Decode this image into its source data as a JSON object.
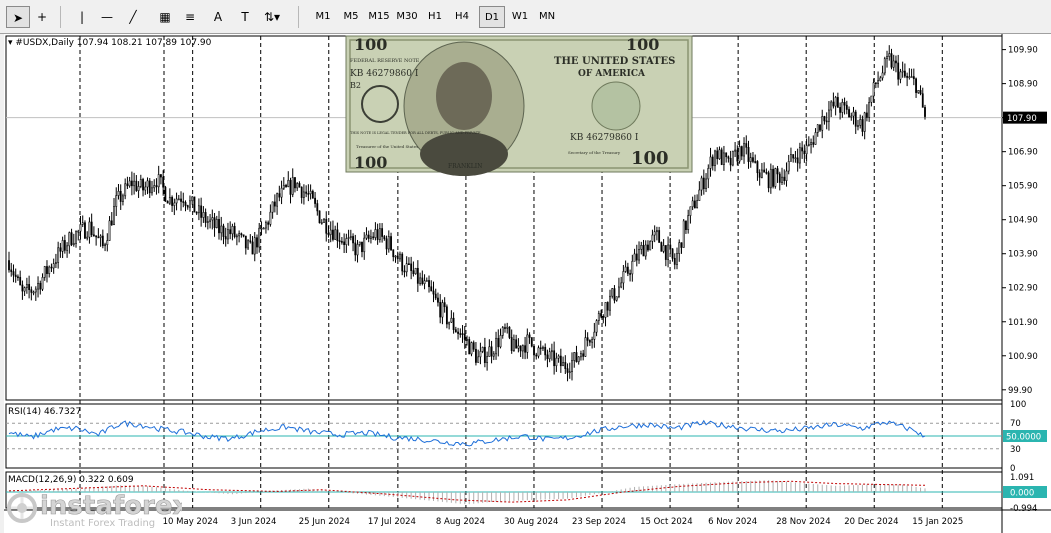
{
  "toolbar": {
    "tools": [
      {
        "name": "cursor-tool",
        "icon": "cursor-icon",
        "glyph": "➤"
      },
      {
        "name": "crosshair-tool",
        "icon": "crosshair-icon",
        "glyph": "+"
      },
      {
        "name": "vertical-line-tool",
        "icon": "vertical-line-icon",
        "glyph": "|"
      },
      {
        "name": "horizontal-line-tool",
        "icon": "horizontal-line-icon",
        "glyph": "—"
      },
      {
        "name": "trendline-tool",
        "icon": "trendline-icon",
        "glyph": "╱"
      },
      {
        "name": "channel-tool",
        "icon": "channel-icon",
        "glyph": "▦"
      },
      {
        "name": "fibonacci-tool",
        "icon": "fibonacci-icon",
        "glyph": "≡"
      },
      {
        "name": "text-tool",
        "icon": "text-icon",
        "glyph": "A"
      },
      {
        "name": "text-label-tool",
        "icon": "text-label-icon",
        "glyph": "T"
      },
      {
        "name": "arrows-tool",
        "icon": "arrows-icon",
        "glyph": "⇅▾"
      }
    ],
    "timeframes": [
      "M1",
      "M5",
      "M15",
      "M30",
      "H1",
      "H4",
      "D1",
      "W1",
      "MN"
    ],
    "active_timeframe": "D1"
  },
  "chart_data": [
    {
      "type": "candlestick",
      "symbol_info": "#USDX,Daily  107.94 108.21 107.89 107.90",
      "current_price_label": "107.90",
      "current_price": 107.9,
      "ylim": [
        99.6,
        110.3
      ],
      "y_ticks": [
        "109.90",
        "108.90",
        "107.90",
        "106.90",
        "105.90",
        "104.90",
        "103.90",
        "102.90",
        "101.90",
        "100.90",
        "99.90"
      ],
      "x_ticks": [
        "10 May 2024",
        "3 Jun 2024",
        "25 Jun 2024",
        "17 Jul 2024",
        "8 Aug 2024",
        "30 Aug 2024",
        "23 Sep 2024",
        "15 Oct 2024",
        "6 Nov 2024",
        "28 Nov 2024",
        "20 Dec 2024",
        "15 Jan 2025"
      ],
      "x_tick_positions": [
        0.184,
        0.249,
        0.314,
        0.38,
        0.445,
        0.51,
        0.575,
        0.64,
        0.705,
        0.77,
        0.835,
        0.9
      ],
      "grid": "vertical-dashed",
      "anchors": [
        [
          0,
          103.7
        ],
        [
          6,
          102.7
        ],
        [
          12,
          102.9
        ],
        [
          20,
          103.7
        ],
        [
          28,
          104.4
        ],
        [
          36,
          104.7
        ],
        [
          42,
          104.1
        ],
        [
          48,
          105.4
        ],
        [
          55,
          106.0
        ],
        [
          60,
          105.8
        ],
        [
          66,
          106.1
        ],
        [
          72,
          105.5
        ],
        [
          78,
          105.6
        ],
        [
          86,
          105.0
        ],
        [
          94,
          104.6
        ],
        [
          100,
          104.5
        ],
        [
          108,
          104.0
        ],
        [
          114,
          104.6
        ],
        [
          120,
          105.5
        ],
        [
          128,
          106.0
        ],
        [
          134,
          105.6
        ],
        [
          140,
          104.9
        ],
        [
          148,
          104.4
        ],
        [
          156,
          104.0
        ],
        [
          164,
          104.5
        ],
        [
          170,
          104.2
        ],
        [
          176,
          103.6
        ],
        [
          182,
          103.2
        ],
        [
          188,
          102.8
        ],
        [
          196,
          102.0
        ],
        [
          204,
          101.4
        ],
        [
          210,
          100.8
        ],
        [
          216,
          101.1
        ],
        [
          222,
          101.6
        ],
        [
          226,
          101.1
        ],
        [
          232,
          101.3
        ],
        [
          240,
          100.9
        ],
        [
          248,
          100.6
        ],
        [
          254,
          100.8
        ],
        [
          260,
          101.5
        ],
        [
          266,
          102.3
        ],
        [
          272,
          102.8
        ],
        [
          278,
          103.5
        ],
        [
          284,
          104.1
        ],
        [
          290,
          104.4
        ],
        [
          294,
          104.0
        ],
        [
          298,
          103.6
        ],
        [
          302,
          104.6
        ],
        [
          310,
          105.9
        ],
        [
          316,
          106.9
        ],
        [
          322,
          106.5
        ],
        [
          328,
          107.0
        ],
        [
          334,
          106.4
        ],
        [
          340,
          106.1
        ],
        [
          346,
          106.2
        ],
        [
          352,
          106.8
        ],
        [
          358,
          107.0
        ],
        [
          364,
          107.9
        ],
        [
          370,
          108.3
        ],
        [
          376,
          108.0
        ],
        [
          382,
          107.7
        ],
        [
          388,
          108.9
        ],
        [
          394,
          109.6
        ],
        [
          400,
          109.1
        ],
        [
          406,
          108.9
        ],
        [
          410,
          107.9
        ]
      ],
      "n_bars": 411
    },
    {
      "type": "line",
      "label": "RSI(14) 46.7327",
      "level_label": "50.0000",
      "ylim": [
        0,
        100
      ],
      "y_ticks": [
        "100",
        "70",
        "30",
        "0"
      ],
      "levels": [
        70,
        50,
        30
      ],
      "anchors": [
        [
          0,
          55
        ],
        [
          10,
          48
        ],
        [
          20,
          60
        ],
        [
          30,
          62
        ],
        [
          40,
          52
        ],
        [
          50,
          70
        ],
        [
          58,
          68
        ],
        [
          66,
          62
        ],
        [
          80,
          55
        ],
        [
          90,
          48
        ],
        [
          100,
          46
        ],
        [
          112,
          58
        ],
        [
          124,
          64
        ],
        [
          136,
          56
        ],
        [
          148,
          52
        ],
        [
          160,
          55
        ],
        [
          172,
          48
        ],
        [
          184,
          45
        ],
        [
          196,
          40
        ],
        [
          206,
          38
        ],
        [
          218,
          44
        ],
        [
          230,
          50
        ],
        [
          242,
          44
        ],
        [
          252,
          48
        ],
        [
          262,
          57
        ],
        [
          274,
          65
        ],
        [
          286,
          68
        ],
        [
          298,
          62
        ],
        [
          310,
          70
        ],
        [
          322,
          66
        ],
        [
          334,
          60
        ],
        [
          346,
          58
        ],
        [
          358,
          62
        ],
        [
          370,
          68
        ],
        [
          382,
          62
        ],
        [
          392,
          72
        ],
        [
          400,
          64
        ],
        [
          406,
          58
        ],
        [
          410,
          46.7
        ]
      ]
    },
    {
      "type": "bar",
      "label": "MACD(12,26,9) 0.322 0.609",
      "level_label": "0.000",
      "ylim": [
        -1.6,
        1.6
      ],
      "y_ticks": [
        "1.091",
        "0.000",
        "-0.994"
      ],
      "anchors": [
        [
          0,
          0.05
        ],
        [
          30,
          0.3
        ],
        [
          50,
          0.6
        ],
        [
          60,
          0.55
        ],
        [
          80,
          0.1
        ],
        [
          100,
          -0.2
        ],
        [
          120,
          0.15
        ],
        [
          134,
          0.3
        ],
        [
          150,
          -0.05
        ],
        [
          170,
          -0.4
        ],
        [
          190,
          -0.8
        ],
        [
          205,
          -1.1
        ],
        [
          215,
          -0.9
        ],
        [
          235,
          -0.7
        ],
        [
          250,
          -0.6
        ],
        [
          262,
          -0.2
        ],
        [
          280,
          0.45
        ],
        [
          300,
          0.7
        ],
        [
          320,
          0.9
        ],
        [
          340,
          1.05
        ],
        [
          355,
          0.8
        ],
        [
          370,
          0.55
        ],
        [
          390,
          0.7
        ],
        [
          400,
          0.65
        ],
        [
          410,
          0.32
        ]
      ],
      "signal_anchors": [
        [
          0,
          0.1
        ],
        [
          40,
          0.4
        ],
        [
          60,
          0.55
        ],
        [
          90,
          0.2
        ],
        [
          120,
          0.05
        ],
        [
          140,
          0.2
        ],
        [
          170,
          -0.2
        ],
        [
          200,
          -0.7
        ],
        [
          225,
          -0.9
        ],
        [
          250,
          -0.7
        ],
        [
          275,
          0.0
        ],
        [
          300,
          0.5
        ],
        [
          330,
          0.85
        ],
        [
          350,
          0.95
        ],
        [
          370,
          0.75
        ],
        [
          395,
          0.65
        ],
        [
          410,
          0.6
        ]
      ]
    }
  ],
  "colors": {
    "bull": "#000000",
    "bear": "#000000",
    "rsi": "#1e6fd9",
    "macd_signal": "#c00000",
    "macd_hist": "#b0b0b0",
    "level": "#2bb5b0"
  },
  "logo": {
    "brand_text": "instaforex",
    "tagline": "Instant Forex Trading"
  },
  "banknote": {
    "denomination": "100",
    "header": "FEDERAL RESERVE NOTE",
    "title_line1": "THE UNITED STATES",
    "title_line2": "OF AMERICA",
    "serial": "KB 46279860 I",
    "plate": "B2",
    "tender_text": "THIS NOTE IS LEGAL TENDER FOR ALL DEBTS, PUBLIC AND PRIVATE",
    "portrait_caption": "FRANKLIN",
    "signature_left": "Treasurer of the United States",
    "signature_right": "Secretary of the Treasury"
  }
}
